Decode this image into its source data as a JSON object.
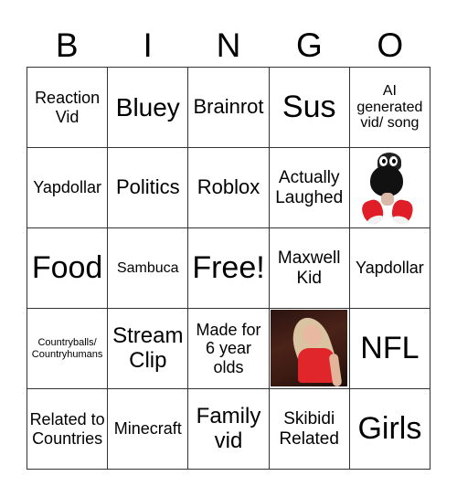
{
  "header": [
    "B",
    "I",
    "N",
    "G",
    "O"
  ],
  "cells": [
    {
      "text": "Reaction Vid",
      "size": "s-md"
    },
    {
      "text": "Bluey",
      "size": "s-xxl"
    },
    {
      "text": "Brainrot",
      "size": "s-lg"
    },
    {
      "text": "Sus",
      "size": "s-huge"
    },
    {
      "text": "AI generated vid/ song",
      "size": "s-sm"
    },
    {
      "text": "Yapdollar",
      "size": "s-md"
    },
    {
      "text": "Politics",
      "size": "s-lg"
    },
    {
      "text": "Roblox",
      "size": "s-lg"
    },
    {
      "text": "Actually Laughed",
      "size": "s-md2"
    },
    {
      "image": "plush-toy-image",
      "text": null
    },
    {
      "text": "Food",
      "size": "s-huge"
    },
    {
      "text": "Sambuca",
      "size": "s-sm"
    },
    {
      "text": "Free!",
      "size": "s-huge"
    },
    {
      "text": "Maxwell Kid",
      "size": "s-md2"
    },
    {
      "text": "Yapdollar",
      "size": "s-md"
    },
    {
      "text": "Countryballs/ Countryhumans",
      "size": "s-xs"
    },
    {
      "text": "Stream Clip",
      "size": "s-xl"
    },
    {
      "text": "Made for 6 year olds",
      "size": "s-md"
    },
    {
      "image": "photo-image",
      "text": null
    },
    {
      "text": "NFL",
      "size": "s-huge"
    },
    {
      "text": "Related to Countries",
      "size": "s-md"
    },
    {
      "text": "Minecraft",
      "size": "s-md"
    },
    {
      "text": "Family vid",
      "size": "s-xl"
    },
    {
      "text": "Skibidi Related",
      "size": "s-md2"
    },
    {
      "text": "Girls",
      "size": "s-huge"
    }
  ]
}
